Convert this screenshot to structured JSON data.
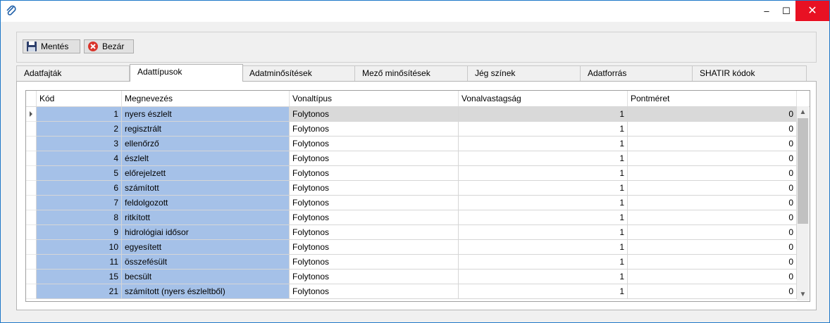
{
  "window": {
    "icon": "paperclip-icon",
    "min_glyph": "–",
    "max_glyph": "☐",
    "close_glyph": "✕"
  },
  "toolbar": {
    "save_label": "Mentés",
    "save_icon": "floppy-disk-icon",
    "close_label": "Bezár",
    "close_icon": "close-circle-icon"
  },
  "tabs": [
    {
      "label": "Adatfajták",
      "active": false
    },
    {
      "label": "Adattípusok",
      "active": true
    },
    {
      "label": "Adatminősítések",
      "active": false
    },
    {
      "label": "Mező minősítések",
      "active": false
    },
    {
      "label": "Jég színek",
      "active": false
    },
    {
      "label": "Adatforrás",
      "active": false
    },
    {
      "label": "SHATIR kódok",
      "active": false
    }
  ],
  "grid": {
    "columns": [
      "Kód",
      "Megnevezés",
      "Vonaltípus",
      "Vonalvastagság",
      "Pontméret"
    ],
    "rows": [
      {
        "kod": "1",
        "nev": "nyers észlelt",
        "tipus": "Folytonos",
        "vastag": "1",
        "pont": "0"
      },
      {
        "kod": "2",
        "nev": "regisztrált",
        "tipus": "Folytonos",
        "vastag": "1",
        "pont": "0"
      },
      {
        "kod": "3",
        "nev": "ellenőrző",
        "tipus": "Folytonos",
        "vastag": "1",
        "pont": "0"
      },
      {
        "kod": "4",
        "nev": "észlelt",
        "tipus": "Folytonos",
        "vastag": "1",
        "pont": "0"
      },
      {
        "kod": "5",
        "nev": "előrejelzett",
        "tipus": "Folytonos",
        "vastag": "1",
        "pont": "0"
      },
      {
        "kod": "6",
        "nev": "számított",
        "tipus": "Folytonos",
        "vastag": "1",
        "pont": "0"
      },
      {
        "kod": "7",
        "nev": "feldolgozott",
        "tipus": "Folytonos",
        "vastag": "1",
        "pont": "0"
      },
      {
        "kod": "8",
        "nev": "ritkított",
        "tipus": "Folytonos",
        "vastag": "1",
        "pont": "0"
      },
      {
        "kod": "9",
        "nev": "hidrológiai idősor",
        "tipus": "Folytonos",
        "vastag": "1",
        "pont": "0"
      },
      {
        "kod": "10",
        "nev": "egyesített",
        "tipus": "Folytonos",
        "vastag": "1",
        "pont": "0"
      },
      {
        "kod": "11",
        "nev": "összefésült",
        "tipus": "Folytonos",
        "vastag": "1",
        "pont": "0"
      },
      {
        "kod": "15",
        "nev": "becsült",
        "tipus": "Folytonos",
        "vastag": "1",
        "pont": "0"
      },
      {
        "kod": "21",
        "nev": "számított (nyers észleltből)",
        "tipus": "Folytonos",
        "vastag": "1",
        "pont": "0"
      }
    ],
    "current_row_index": 0,
    "colors": {
      "selected": "#a5c1e8",
      "current": "#d9d9d9"
    }
  }
}
